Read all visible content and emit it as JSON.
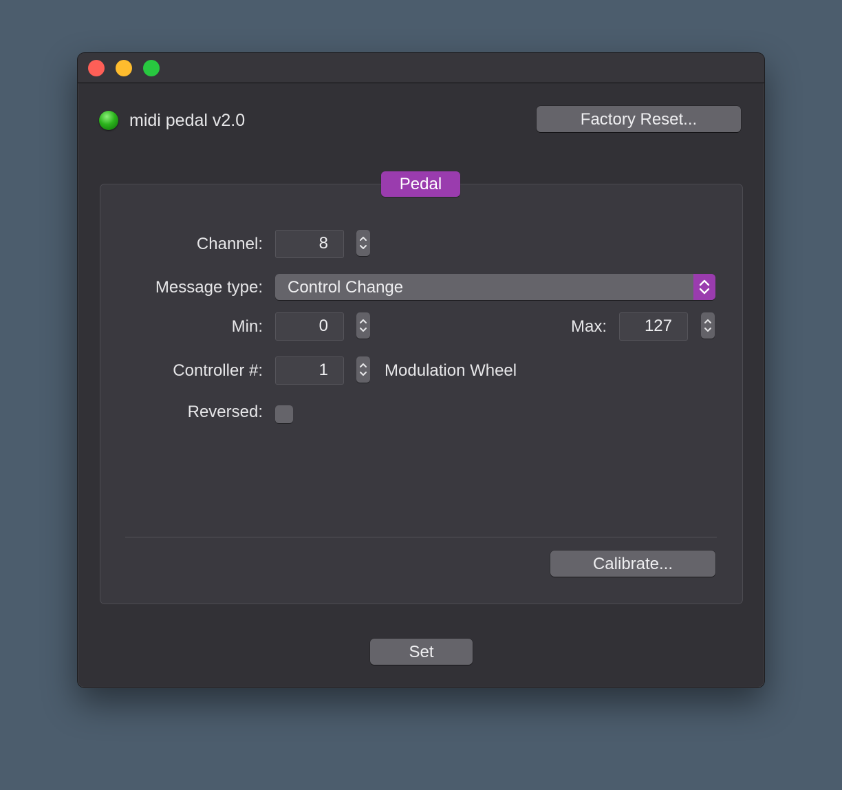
{
  "window": {
    "controls": [
      "close",
      "minimize",
      "zoom"
    ]
  },
  "header": {
    "status_icon": "green-led-icon",
    "title": "midi pedal v2.0",
    "factory_reset_label": "Factory Reset..."
  },
  "pedal_group": {
    "tab_label": "Pedal",
    "channel": {
      "label": "Channel:",
      "value": "8"
    },
    "message_type": {
      "label": "Message type:",
      "value": "Control Change"
    },
    "min": {
      "label": "Min:",
      "value": "0"
    },
    "max": {
      "label": "Max:",
      "value": "127"
    },
    "controller": {
      "label": "Controller #:",
      "value": "1",
      "name": "Modulation Wheel"
    },
    "reversed": {
      "label": "Reversed:",
      "checked": false
    },
    "calibrate_label": "Calibrate..."
  },
  "footer": {
    "set_label": "Set"
  },
  "colors": {
    "accent": "#9a3cae",
    "background": "#4c5d6d",
    "window": "#323136",
    "led": "#2bb21c"
  }
}
